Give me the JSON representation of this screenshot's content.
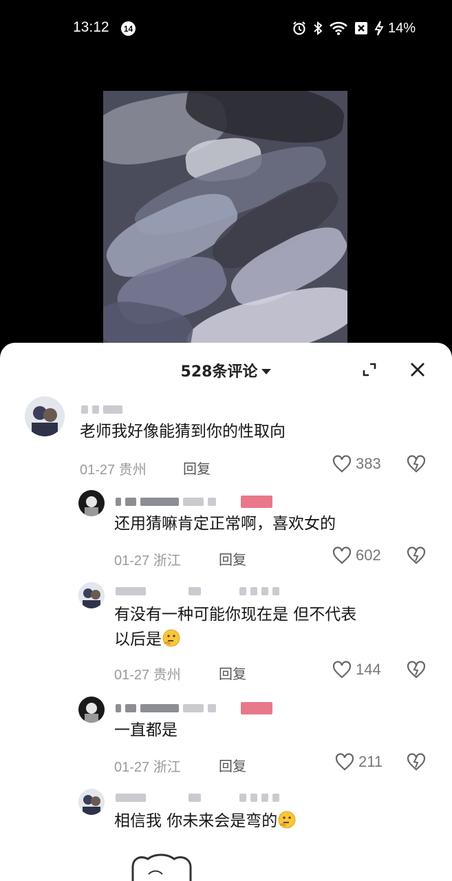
{
  "status_bar": {
    "time": "13:12",
    "notification_count": "14",
    "battery": "14%",
    "icons": [
      "alarm-icon",
      "bluetooth-icon",
      "wifi-icon",
      "sim-off-icon",
      "charging-icon"
    ]
  },
  "comments_panel": {
    "count_label": "528条评论",
    "reply_label": "回复",
    "comments": [
      {
        "text": "老师我好像能猜到你的性取向",
        "date": "01-27",
        "location": "贵州",
        "likes": "383"
      },
      {
        "text": "还用猜嘛肯定正常啊，喜欢女的",
        "date": "01-27",
        "location": "浙江",
        "likes": "602"
      },
      {
        "text_line1": "有没有一种可能你现在是   但不代表",
        "text_line2": "以后是",
        "date": "01-27",
        "location": "贵州",
        "likes": "144"
      },
      {
        "text": "一直都是",
        "date": "01-27",
        "location": "浙江",
        "likes": "211"
      },
      {
        "text": "相信我   你未来会是弯的"
      }
    ]
  },
  "colors": {
    "sheet_bg": "#ffffff",
    "text": "#161616",
    "meta": "#9a9a9a",
    "redacted_pink": "#e8788a"
  }
}
